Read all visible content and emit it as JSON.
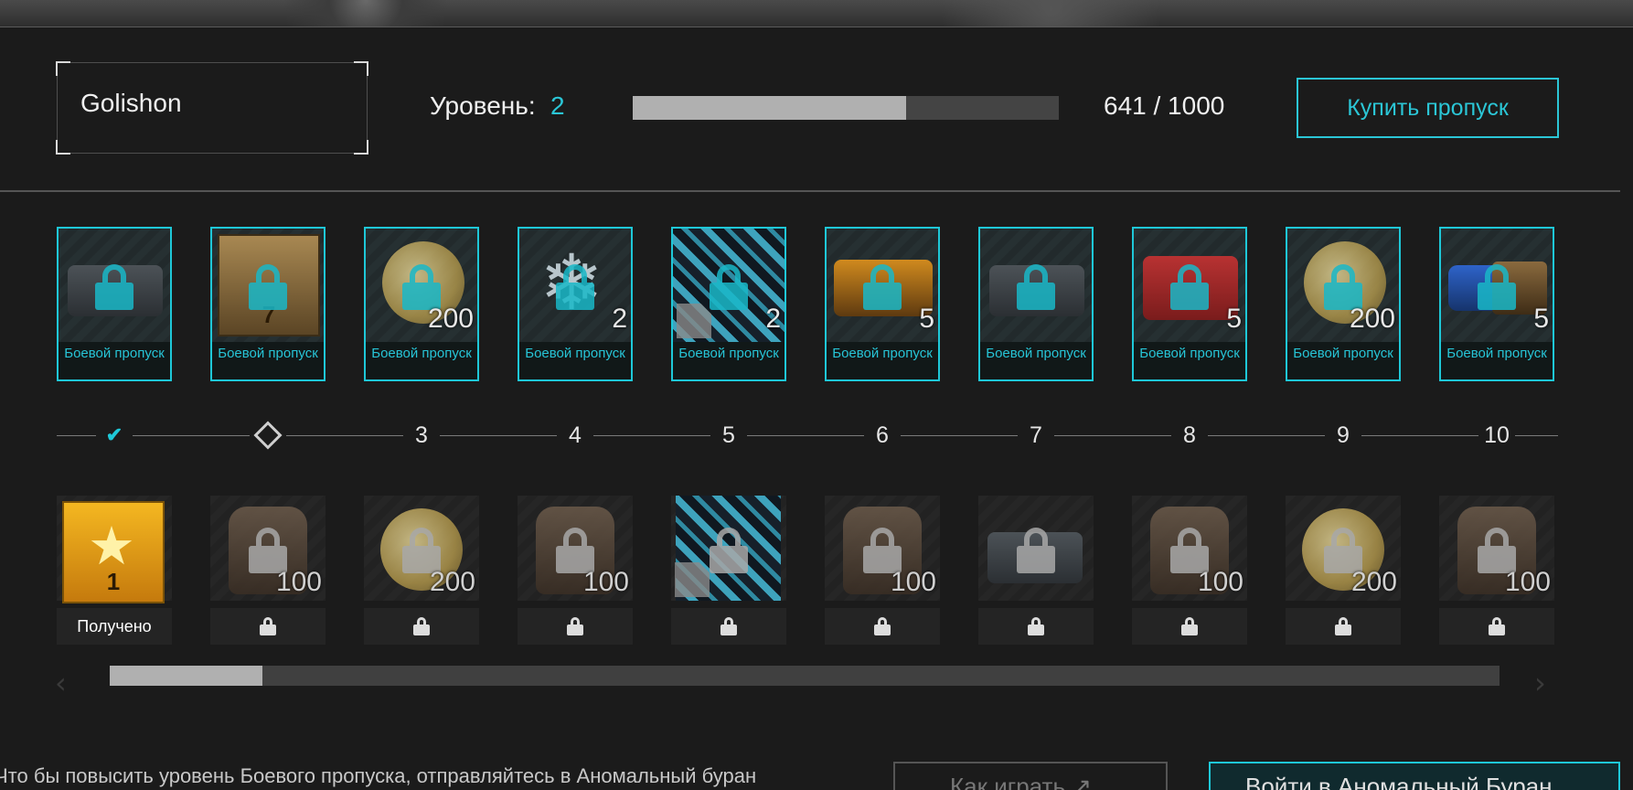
{
  "player": {
    "name": "Golishon"
  },
  "level": {
    "label": "Уровень:",
    "value": "2"
  },
  "xp": {
    "text": "641 / 1000",
    "current": 641,
    "max": 1000
  },
  "buttons": {
    "buy_pass": "Купить пропуск",
    "how_to_play": "Как играть",
    "enter": "Войти в Аномальный Буран"
  },
  "premium_label": "Боевой пропуск",
  "premium_rewards": [
    {
      "item": "dark-case-icon",
      "qty": ""
    },
    {
      "item": "laurel-badge-icon",
      "badge_num": "7",
      "qty": ""
    },
    {
      "item": "coin-icon",
      "qty": "200"
    },
    {
      "item": "snowflake-icon",
      "qty": "2"
    },
    {
      "item": "camo-icon",
      "qty": "2"
    },
    {
      "item": "orange-box-icon",
      "qty": "5"
    },
    {
      "item": "dark-box-icon",
      "qty": ""
    },
    {
      "item": "red-box-icon",
      "qty": "5"
    },
    {
      "item": "coin-icon",
      "qty": "200"
    },
    {
      "item": "blue-box-icon",
      "qty": "5"
    }
  ],
  "track_nodes": [
    "✔",
    "",
    "3",
    "4",
    "5",
    "6",
    "7",
    "8",
    "9",
    "10"
  ],
  "free_rewards": [
    {
      "item": "gold-badge-icon",
      "badge_num": "1",
      "qty": "",
      "status": "Получено"
    },
    {
      "item": "meds-icon",
      "qty": "100",
      "status": ""
    },
    {
      "item": "coin-icon",
      "qty": "200",
      "status": ""
    },
    {
      "item": "meds-icon",
      "qty": "100",
      "status": ""
    },
    {
      "item": "camo-icon",
      "qty": "",
      "status": ""
    },
    {
      "item": "meds-icon",
      "qty": "100",
      "status": ""
    },
    {
      "item": "dark-box-icon",
      "qty": "",
      "status": ""
    },
    {
      "item": "meds-icon",
      "qty": "100",
      "status": ""
    },
    {
      "item": "coin-icon",
      "qty": "200",
      "status": ""
    },
    {
      "item": "meds-icon",
      "qty": "100",
      "status": ""
    }
  ],
  "scroll": {
    "position_fraction": 0.11
  },
  "hint": "Что бы повысить уровень Боевого пропуска, отправляйтесь в Аномальный буран",
  "colors": {
    "accent": "#1ec8d8",
    "xp_fill": "#b0b0b0",
    "gold": "#f4b721"
  }
}
